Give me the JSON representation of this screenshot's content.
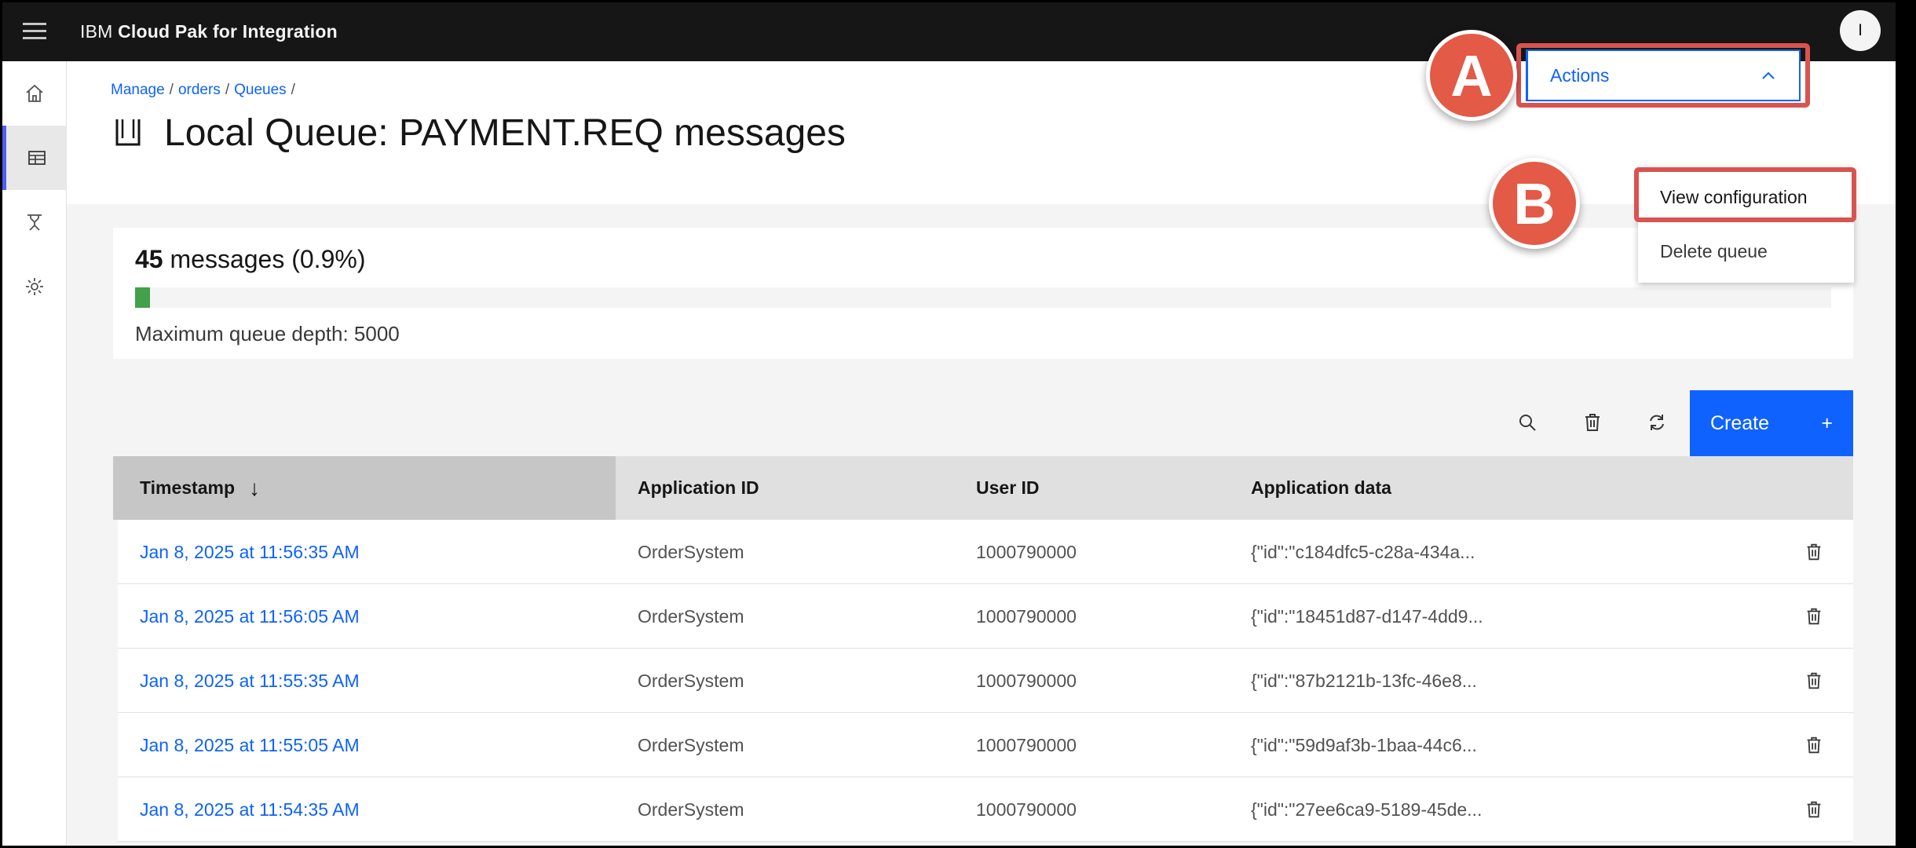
{
  "app": {
    "brand_ibm": "IBM",
    "brand_product": "Cloud Pak for Integration",
    "avatar_initial": "I"
  },
  "breadcrumb": [
    {
      "label": "Manage"
    },
    {
      "label": "orders"
    },
    {
      "label": "Queues"
    }
  ],
  "page": {
    "title": "Local Queue: PAYMENT.REQ messages"
  },
  "actions": {
    "label": "Actions",
    "menu": [
      "View configuration",
      "Delete queue"
    ]
  },
  "callouts": {
    "a": "A",
    "b": "B"
  },
  "summary": {
    "count": "45",
    "count_suffix": "messages (0.9%)",
    "fill_fraction": 0.009,
    "max_depth_text": "Maximum queue depth: 5000"
  },
  "toolbar": {
    "create_label": "Create",
    "create_plus": "+"
  },
  "table": {
    "columns": [
      "Timestamp",
      "Application ID",
      "User ID",
      "Application data"
    ],
    "sort_indicator": "↓",
    "rows": [
      {
        "timestamp": "Jan 8, 2025 at 11:56:35 AM",
        "app_id": "OrderSystem",
        "user_id": "1000790000",
        "data": "{\"id\":\"c184dfc5-c28a-434a..."
      },
      {
        "timestamp": "Jan 8, 2025 at 11:56:05 AM",
        "app_id": "OrderSystem",
        "user_id": "1000790000",
        "data": "{\"id\":\"18451d87-d147-4dd9..."
      },
      {
        "timestamp": "Jan 8, 2025 at 11:55:35 AM",
        "app_id": "OrderSystem",
        "user_id": "1000790000",
        "data": "{\"id\":\"87b2121b-13fc-46e8..."
      },
      {
        "timestamp": "Jan 8, 2025 at 11:55:05 AM",
        "app_id": "OrderSystem",
        "user_id": "1000790000",
        "data": "{\"id\":\"59d9af3b-1baa-44c6..."
      },
      {
        "timestamp": "Jan 8, 2025 at 11:54:35 AM",
        "app_id": "OrderSystem",
        "user_id": "1000790000",
        "data": "{\"id\":\"27ee6ca9-5189-45de..."
      }
    ]
  },
  "colors": {
    "accent": "#0f62fe",
    "progress": "#42a14a",
    "callout": "#e35a46"
  },
  "icons": {
    "rail": [
      "home-icon",
      "table-icon",
      "cluster-icon",
      "settings-icon"
    ],
    "toolbar": [
      "search-icon",
      "trash-icon",
      "refresh-icon"
    ]
  }
}
